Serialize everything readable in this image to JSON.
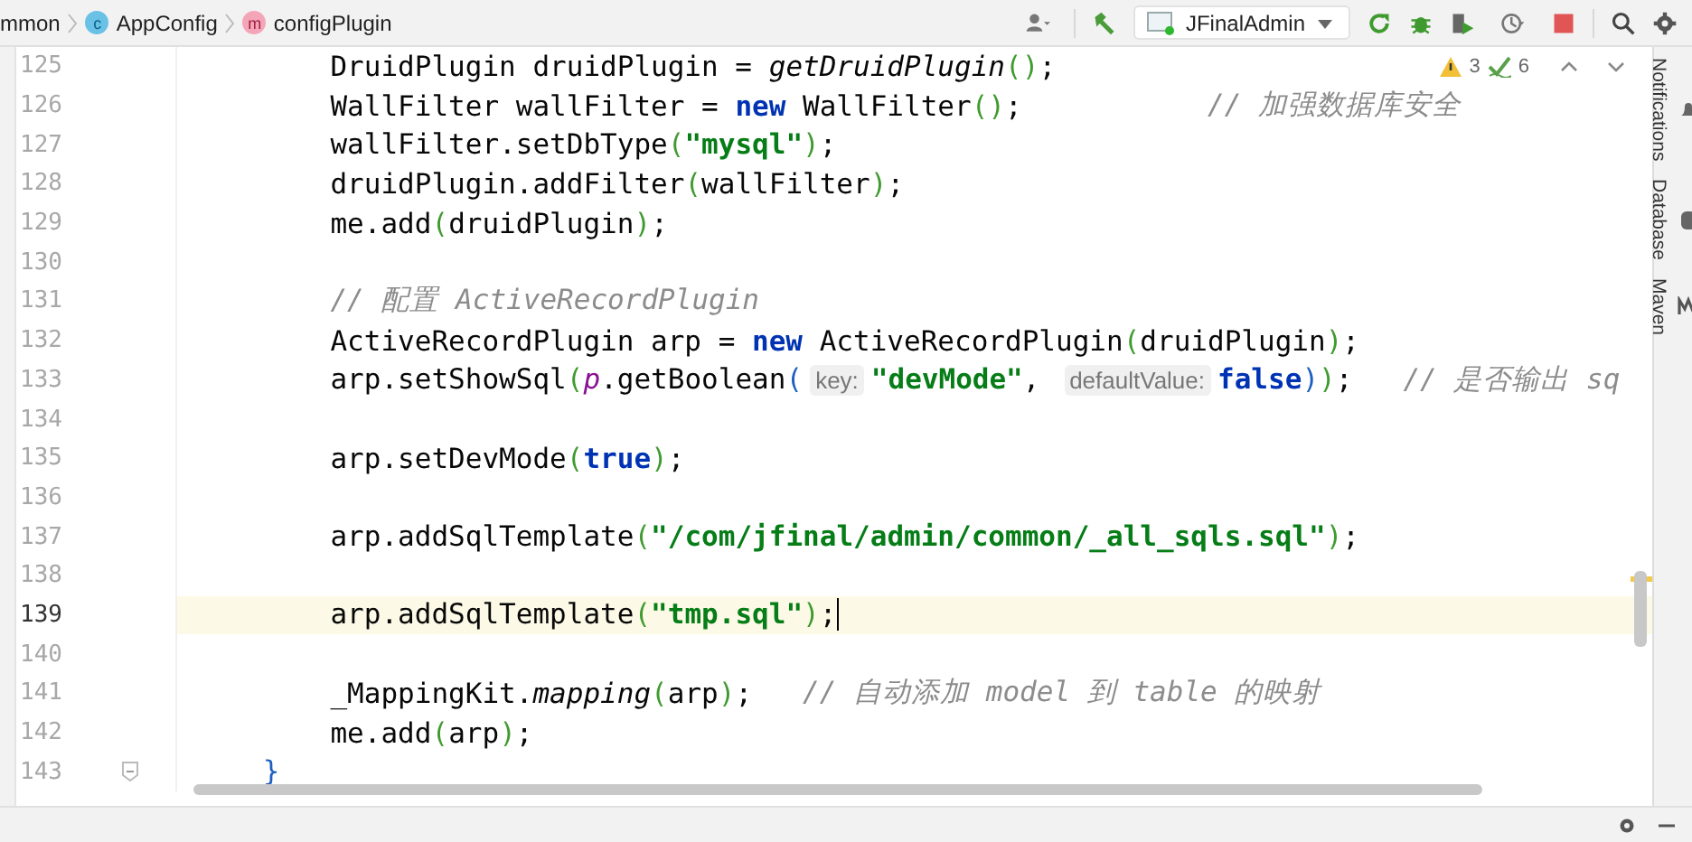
{
  "breadcrumb": [
    {
      "label": "mmon",
      "kind": "package"
    },
    {
      "label": "AppConfig",
      "kind": "class",
      "badge": "c"
    },
    {
      "label": "configPlugin",
      "kind": "method",
      "badge": "m"
    }
  ],
  "toolbar": {
    "run_config": "JFinalAdmin"
  },
  "inspections": {
    "warnings": "3",
    "weak_warnings": "6"
  },
  "code": {
    "children": [
      {
        "children": [
          {
            "number": "125",
            "current": false,
            "tokens": [
              {
                "kind": "text",
                "text": "DruidPlugin druidPlugin = "
              },
              {
                "kind": "italic",
                "text": "getDruidPlugin"
              },
              {
                "kind": "p1",
                "text": "()"
              },
              {
                "kind": "text",
                "text": ";"
              }
            ]
          },
          {
            "number": "126",
            "current": false,
            "tokens": [
              {
                "kind": "text",
                "text": "WallFilter wallFilter = "
              },
              {
                "kind": "kw",
                "text": "new"
              },
              {
                "kind": "text",
                "text": " WallFilter"
              },
              {
                "kind": "p1",
                "text": "()"
              },
              {
                "kind": "text",
                "text": ";           "
              },
              {
                "kind": "comment",
                "text": "// 加强数据库安全"
              }
            ]
          },
          {
            "number": "127",
            "current": false,
            "tokens": [
              {
                "kind": "text",
                "text": "wallFilter.setDbType"
              },
              {
                "kind": "p1",
                "text": "("
              },
              {
                "kind": "str",
                "text": "\"mysql\""
              },
              {
                "kind": "p1",
                "text": ")"
              },
              {
                "kind": "text",
                "text": ";"
              }
            ]
          },
          {
            "number": "128",
            "current": false,
            "tokens": [
              {
                "kind": "text",
                "text": "druidPlugin.addFilter"
              },
              {
                "kind": "p1",
                "text": "("
              },
              {
                "kind": "text",
                "text": "wallFilter"
              },
              {
                "kind": "p1",
                "text": ")"
              },
              {
                "kind": "text",
                "text": ";"
              }
            ]
          },
          {
            "number": "129",
            "current": false,
            "tokens": [
              {
                "kind": "text",
                "text": "me.add"
              },
              {
                "kind": "p1",
                "text": "("
              },
              {
                "kind": "text",
                "text": "druidPlugin"
              },
              {
                "kind": "p1",
                "text": ")"
              },
              {
                "kind": "text",
                "text": ";"
              }
            ]
          },
          {
            "number": "130",
            "current": false
          },
          {
            "number": "131",
            "current": false,
            "tokens": [
              {
                "kind": "comment",
                "text": "// 配置 ActiveRecordPlugin"
              }
            ]
          },
          {
            "number": "132",
            "current": false,
            "tokens": [
              {
                "kind": "text",
                "text": "ActiveRecordPlugin arp = "
              },
              {
                "kind": "kw",
                "text": "new"
              },
              {
                "kind": "text",
                "text": " ActiveRecordPlugin"
              },
              {
                "kind": "p1",
                "text": "("
              },
              {
                "kind": "text",
                "text": "druidPlugin"
              },
              {
                "kind": "p1",
                "text": ")"
              },
              {
                "kind": "text",
                "text": ";"
              }
            ]
          },
          {
            "number": "133",
            "current": false,
            "tokens": [
              {
                "kind": "text",
                "text": "arp.setShowSql"
              },
              {
                "kind": "p1",
                "text": "("
              },
              {
                "kind": "field",
                "text": "p"
              },
              {
                "kind": "text",
                "text": ".getBoolean"
              },
              {
                "kind": "p2",
                "text": "("
              },
              {
                "kind": "hint",
                "text": "key:"
              },
              {
                "kind": "str",
                "text": "\"devMode\""
              },
              {
                "kind": "text",
                "text": ", "
              },
              {
                "kind": "hint",
                "text": "defaultValue:"
              },
              {
                "kind": "kw",
                "text": "false"
              },
              {
                "kind": "p2",
                "text": ")"
              },
              {
                "kind": "p1",
                "text": ")"
              },
              {
                "kind": "text",
                "text": ";   "
              },
              {
                "kind": "comment",
                "text": "// 是否输出 sq"
              }
            ]
          },
          {
            "number": "134",
            "current": false
          },
          {
            "number": "135",
            "current": false,
            "tokens": [
              {
                "kind": "text",
                "text": "arp.setDevMode"
              },
              {
                "kind": "p1",
                "text": "("
              },
              {
                "kind": "kw",
                "text": "true"
              },
              {
                "kind": "p1",
                "text": ")"
              },
              {
                "kind": "text",
                "text": ";"
              }
            ]
          },
          {
            "number": "136",
            "current": false
          },
          {
            "number": "137",
            "current": false,
            "tokens": [
              {
                "kind": "text",
                "text": "arp.addSqlTemplate"
              },
              {
                "kind": "p1",
                "text": "("
              },
              {
                "kind": "str",
                "text": "\"/com/jfinal/admin/common/_all_sqls.sql\""
              },
              {
                "kind": "p1",
                "text": ")"
              },
              {
                "kind": "text",
                "text": ";"
              }
            ]
          },
          {
            "number": "138",
            "current": false
          },
          {
            "number": "139",
            "current": true,
            "tokens": [
              {
                "kind": "text",
                "text": "arp.addSqlTemplate"
              },
              {
                "kind": "p1",
                "text": "("
              },
              {
                "kind": "str",
                "text": "\"tmp.sql\""
              },
              {
                "kind": "p1",
                "text": ")"
              },
              {
                "kind": "text",
                "text": ";"
              }
            ]
          },
          {
            "number": "140",
            "current": false
          },
          {
            "number": "141",
            "current": false,
            "tokens": [
              {
                "kind": "text",
                "text": "_MappingKit."
              },
              {
                "kind": "italic",
                "text": "mapping"
              },
              {
                "kind": "p1",
                "text": "("
              },
              {
                "kind": "text",
                "text": "arp"
              },
              {
                "kind": "p1",
                "text": ")"
              },
              {
                "kind": "text",
                "text": ";   "
              },
              {
                "kind": "comment",
                "text": "// 自动添加 model 到 table 的映射"
              }
            ]
          },
          {
            "number": "142",
            "current": false,
            "tokens": [
              {
                "kind": "text",
                "text": "me.add"
              },
              {
                "kind": "p1",
                "text": "("
              },
              {
                "kind": "text",
                "text": "arp"
              },
              {
                "kind": "p1",
                "text": ")"
              },
              {
                "kind": "text",
                "text": ";"
              }
            ]
          }
        ]
      },
      {
        "number": "143",
        "current": false,
        "fold": true,
        "tokens": [
          {
            "kind": "brace",
            "text": "}"
          }
        ]
      }
    ]
  },
  "side_tools": [
    {
      "label": "Notifications",
      "kind": "bell"
    },
    {
      "label": "Database",
      "kind": "database"
    },
    {
      "label": "Maven",
      "kind": "maven"
    }
  ]
}
